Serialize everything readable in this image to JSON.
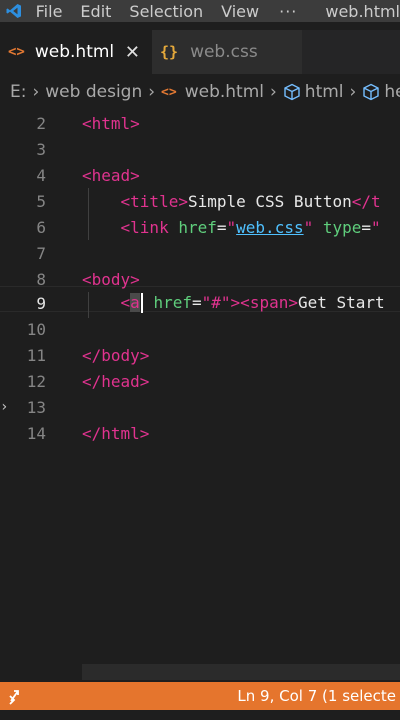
{
  "titlebar": {
    "menu": [
      "File",
      "Edit",
      "Selection",
      "View"
    ],
    "more": "···",
    "window_title": "web.html"
  },
  "tabs": [
    {
      "label": "web.html",
      "icon": "html-file-icon",
      "close": "✕"
    },
    {
      "label": "web.css",
      "icon": "css-file-icon"
    }
  ],
  "breadcrumb": {
    "drive": "E:",
    "folder": "web design",
    "file": "web.html",
    "element": "html",
    "element2": "he"
  },
  "editor": {
    "current_line": 9,
    "lines": [
      {
        "n": "2"
      },
      {
        "n": "3"
      },
      {
        "n": "4"
      },
      {
        "n": "5",
        "title_text": "Simple CSS Button"
      },
      {
        "n": "6",
        "href_value": "web.css"
      },
      {
        "n": "7"
      },
      {
        "n": "8"
      },
      {
        "n": "9",
        "href_value": "#",
        "span_text": "Get Start"
      },
      {
        "n": "10"
      },
      {
        "n": "11"
      },
      {
        "n": "12"
      },
      {
        "n": "13"
      },
      {
        "n": "14"
      }
    ]
  },
  "statusbar": {
    "position": "Ln 9, Col 7 (1 selecte"
  },
  "colors": {
    "accent": "#e5752d",
    "tag": "#e0338f",
    "attribute": "#5fce7c",
    "link": "#4fc1ff"
  }
}
